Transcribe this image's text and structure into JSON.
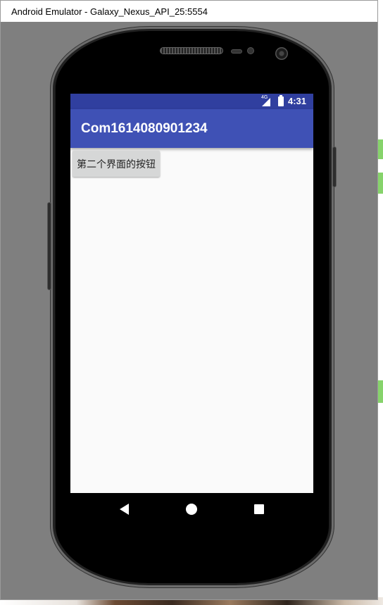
{
  "window": {
    "title": "Android Emulator - Galaxy_Nexus_API_25:5554"
  },
  "status_bar": {
    "network_label": "4G",
    "time": "4:31"
  },
  "app_bar": {
    "title": "Com1614080901234"
  },
  "content": {
    "button_label": "第二个界面的按钮"
  },
  "nav_bar": {
    "icons": [
      "back-icon",
      "home-icon",
      "recents-icon"
    ]
  },
  "colors": {
    "status_bar": "#303F9F",
    "app_bar": "#3F51B5",
    "screen_background": "#FAFAFA",
    "button_background": "#D6D7D7",
    "emulator_frame": "#7F7F7F"
  }
}
